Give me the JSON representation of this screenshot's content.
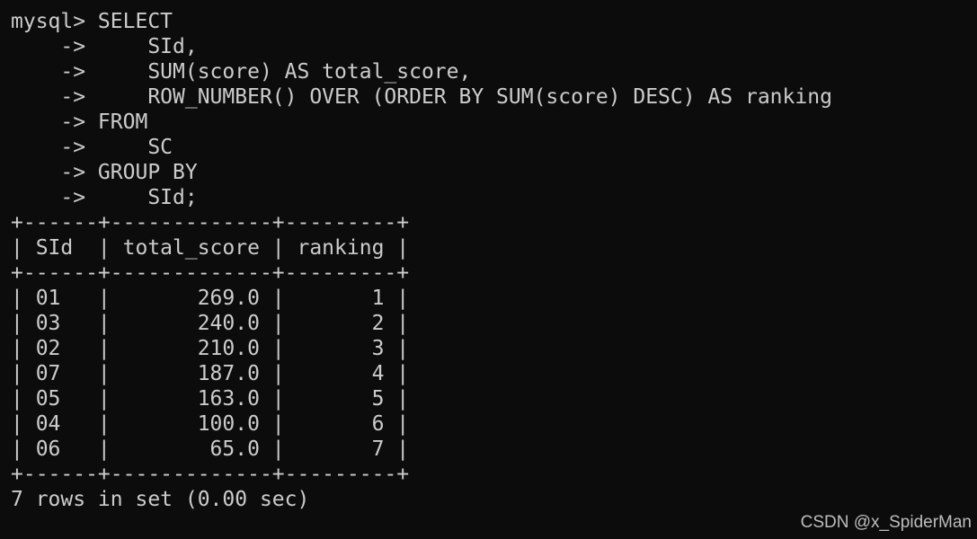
{
  "terminal": {
    "lines": [
      "mysql> SELECT",
      "    ->     SId,",
      "    ->     SUM(score) AS total_score,",
      "    ->     ROW_NUMBER() OVER (ORDER BY SUM(score) DESC) AS ranking",
      "    -> FROM",
      "    ->     SC",
      "    -> GROUP BY",
      "    ->     SId;",
      "+------+-------------+---------+",
      "| SId  | total_score | ranking |",
      "+------+-------------+---------+",
      "| 01   |       269.0 |       1 |",
      "| 03   |       240.0 |       2 |",
      "| 02   |       210.0 |       3 |",
      "| 07   |       187.0 |       4 |",
      "| 05   |       163.0 |       5 |",
      "| 04   |       100.0 |       6 |",
      "| 06   |        65.0 |       7 |",
      "+------+-------------+---------+",
      "7 rows in set (0.00 sec)"
    ]
  },
  "watermark": "CSDN @x_SpiderMan",
  "colors": {
    "background": "#0c0c0c",
    "text": "#cccccc"
  }
}
